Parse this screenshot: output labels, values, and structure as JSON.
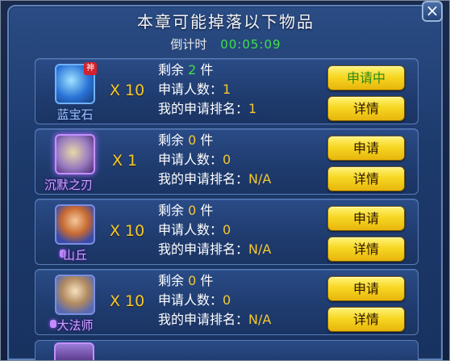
{
  "dialog": {
    "title": "本章可能掉落以下物品",
    "countdown_label": "倒计时",
    "countdown_time": "00:05:09",
    "close_glyph": "×"
  },
  "labels": {
    "remaining_prefix": "剩余",
    "remaining_suffix": "件",
    "applicants": "申请人数：",
    "my_rank": "我的申请排名："
  },
  "items": [
    {
      "name": "蓝宝石",
      "badge": "神",
      "icon": "sapphire-icon",
      "quantity": "X 10",
      "remaining": "2",
      "applicants": "1",
      "rank": "1",
      "apply_label": "申请中",
      "detail_label": "详情",
      "applied": true
    },
    {
      "name": "沉默之刃",
      "icon": "scroll-icon",
      "quantity": "X 1",
      "remaining": "0",
      "applicants": "0",
      "rank": "N/A",
      "apply_label": "申请",
      "detail_label": "详情",
      "applied": false
    },
    {
      "name": "山丘",
      "icon": "mountain-king-hero-icon",
      "quantity": "X 10",
      "remaining": "0",
      "applicants": "0",
      "rank": "N/A",
      "apply_label": "申请",
      "detail_label": "详情",
      "applied": false
    },
    {
      "name": "大法师",
      "icon": "archmage-hero-icon",
      "quantity": "X 10",
      "remaining": "0",
      "applicants": "0",
      "rank": "N/A",
      "apply_label": "申请",
      "detail_label": "详情",
      "applied": false
    }
  ],
  "colors": {
    "accent_yellow": "#f5c830",
    "timer_green": "#3fe04a",
    "panel_blue": "#1f3b6e"
  }
}
